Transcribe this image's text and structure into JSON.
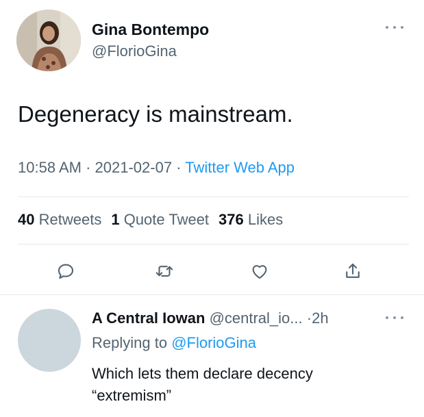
{
  "tweet": {
    "author_name": "Gina Bontempo",
    "author_handle": "@FlorioGina",
    "text": "Degeneracy is mainstream.",
    "time": "10:58 AM",
    "date": "2021-02-07",
    "separator": "·",
    "source": "Twitter Web App",
    "stats": {
      "retweets_count": "40",
      "retweets_label": "Retweets",
      "quotes_count": "1",
      "quotes_label": "Quote Tweet",
      "likes_count": "376",
      "likes_label": "Likes"
    },
    "actions": [
      "reply-icon",
      "retweet-icon",
      "like-icon",
      "share-icon"
    ],
    "more_icon": "more-horizontal-icon"
  },
  "reply": {
    "author_name": "A Central Iowan",
    "author_handle": "@central_io...",
    "separator": "·",
    "age": "2h",
    "replying_prefix": "Replying to",
    "replying_handle": "@FlorioGina",
    "text": "Which lets them declare decency “extremism”"
  },
  "colors": {
    "accent": "#1d9bf0",
    "secondary_text": "#536471",
    "primary_text": "#0f1419",
    "divider": "#e3e7ea",
    "placeholder_avatar": "#ccd6dd"
  }
}
